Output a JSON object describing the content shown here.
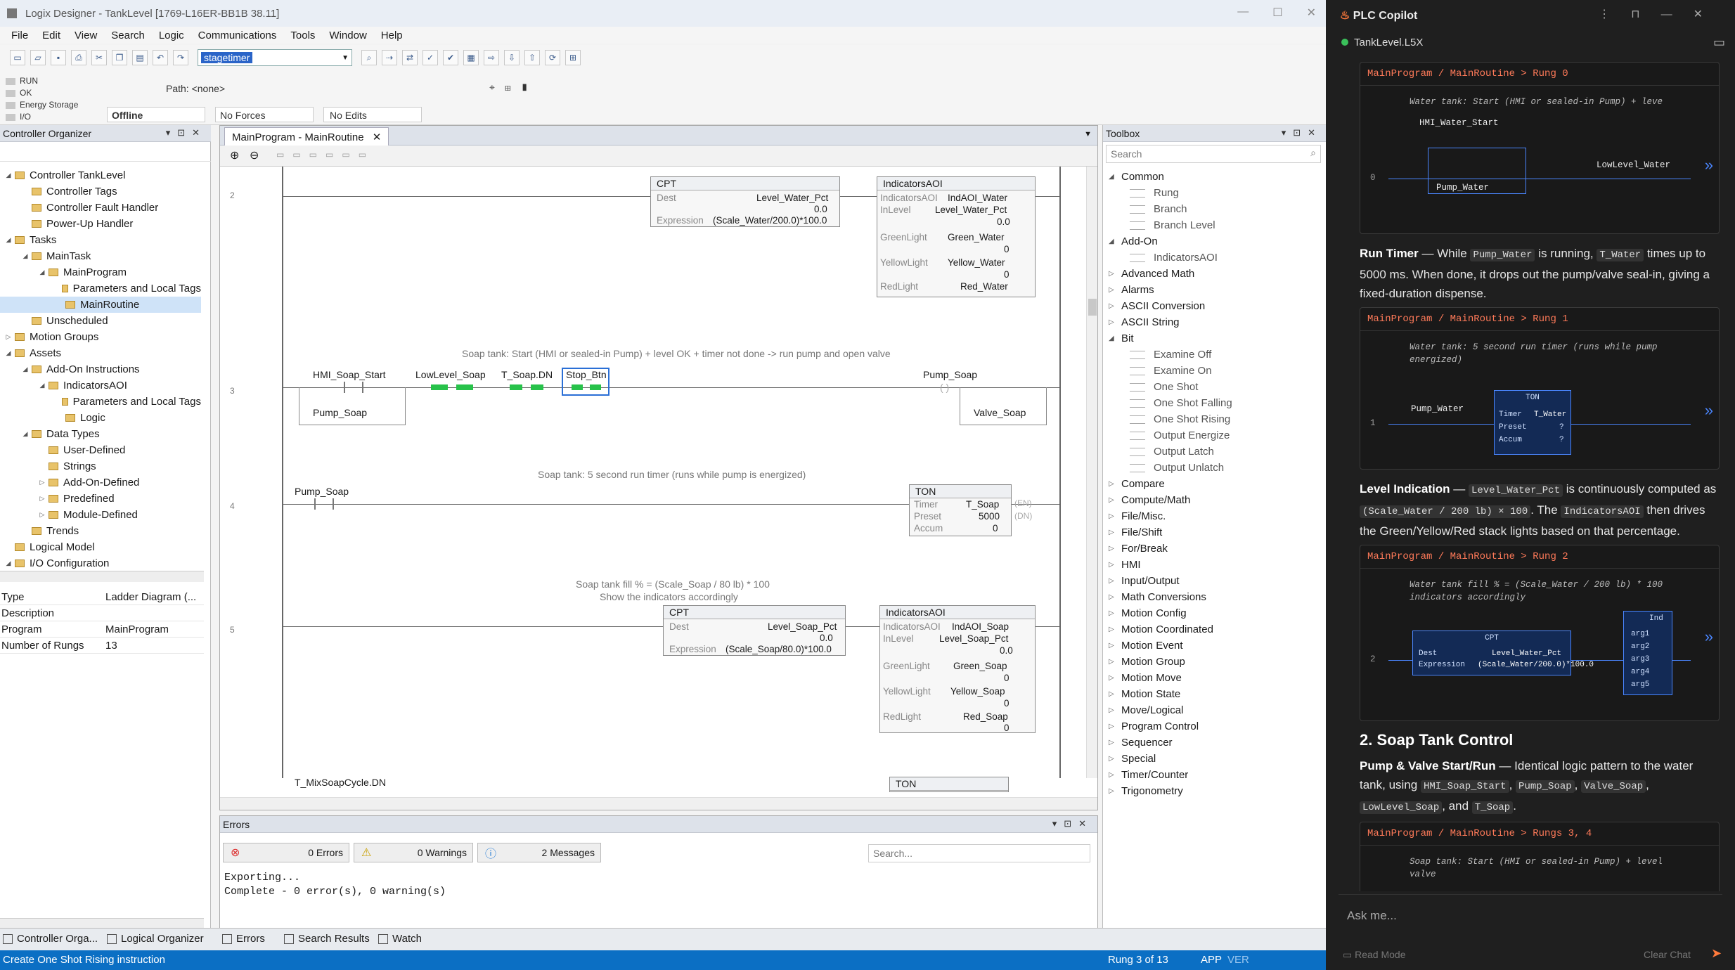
{
  "window": {
    "title": "Logix Designer - TankLevel [1769-L16ER-BB1B 38.11]"
  },
  "menu": [
    "File",
    "Edit",
    "View",
    "Search",
    "Logic",
    "Communications",
    "Tools",
    "Window",
    "Help"
  ],
  "toolbar": {
    "combo_value": "stagetimer"
  },
  "controller_status": {
    "run": "RUN",
    "ok": "OK",
    "energy": "Energy Storage",
    "io": "I/O",
    "mode": "Offline",
    "forces": "No Forces",
    "edits": "No Edits",
    "path_label": "Path:",
    "path_value": "<none>"
  },
  "organizer": {
    "title": "Controller Organizer",
    "tree": [
      {
        "label": "Controller TankLevel",
        "indent": 0,
        "exp": "◢"
      },
      {
        "label": "Controller Tags",
        "indent": 1,
        "exp": ""
      },
      {
        "label": "Controller Fault Handler",
        "indent": 1,
        "exp": ""
      },
      {
        "label": "Power-Up Handler",
        "indent": 1,
        "exp": ""
      },
      {
        "label": "Tasks",
        "indent": 0,
        "exp": "◢"
      },
      {
        "label": "MainTask",
        "indent": 1,
        "exp": "◢"
      },
      {
        "label": "MainProgram",
        "indent": 2,
        "exp": "◢"
      },
      {
        "label": "Parameters and Local Tags",
        "indent": 3,
        "exp": ""
      },
      {
        "label": "MainRoutine",
        "indent": 3,
        "exp": "",
        "selected": true
      },
      {
        "label": "Unscheduled",
        "indent": 1,
        "exp": ""
      },
      {
        "label": "Motion Groups",
        "indent": 0,
        "exp": "▷"
      },
      {
        "label": "Assets",
        "indent": 0,
        "exp": "◢"
      },
      {
        "label": "Add-On Instructions",
        "indent": 1,
        "exp": "◢"
      },
      {
        "label": "IndicatorsAOI",
        "indent": 2,
        "exp": "◢"
      },
      {
        "label": "Parameters and Local Tags",
        "indent": 3,
        "exp": ""
      },
      {
        "label": "Logic",
        "indent": 3,
        "exp": ""
      },
      {
        "label": "Data Types",
        "indent": 1,
        "exp": "◢"
      },
      {
        "label": "User-Defined",
        "indent": 2,
        "exp": ""
      },
      {
        "label": "Strings",
        "indent": 2,
        "exp": ""
      },
      {
        "label": "Add-On-Defined",
        "indent": 2,
        "exp": "▷"
      },
      {
        "label": "Predefined",
        "indent": 2,
        "exp": "▷"
      },
      {
        "label": "Module-Defined",
        "indent": 2,
        "exp": "▷"
      },
      {
        "label": "Trends",
        "indent": 1,
        "exp": ""
      },
      {
        "label": "Logical Model",
        "indent": 0,
        "exp": ""
      },
      {
        "label": "I/O Configuration",
        "indent": 0,
        "exp": "◢"
      }
    ],
    "props": [
      {
        "k": "Type",
        "v": "Ladder Diagram (..."
      },
      {
        "k": "Description",
        "v": ""
      },
      {
        "k": "Program",
        "v": "MainProgram"
      },
      {
        "k": "Number of Rungs",
        "v": "13"
      }
    ]
  },
  "editor": {
    "tab": "MainProgram - MainRoutine",
    "rung2": {
      "cpt_title": "CPT",
      "cpt_dest_label": "Dest",
      "cpt_dest": "Level_Water_Pct",
      "cpt_dest_val": "0.0",
      "cpt_expr_label": "Expression",
      "cpt_expr": "(Scale_Water/200.0)*100.0",
      "aoi_title": "IndicatorsAOI",
      "aoi_inst": "IndAOI_Water",
      "aoi_inlevel": "Level_Water_Pct",
      "aoi_inlevel_val": "0.0",
      "aoi_green": "Green_Water",
      "aoi_yellow": "Yellow_Water",
      "aoi_red": "Red_Water",
      "zero": "0"
    },
    "rung3": {
      "comment": "Soap tank: Start (HMI or sealed-in Pump) + level OK + timer not done -> run pump and open valve",
      "c1": "HMI_Soap_Start",
      "c2": "LowLevel_Soap",
      "c3": "T_Soap.DN",
      "c4": "Stop_Btn",
      "seal": "Pump_Soap",
      "out1": "Pump_Soap",
      "out2": "Valve_Soap"
    },
    "rung4": {
      "comment": "Soap tank: 5 second run timer (runs while pump is energized)",
      "c1": "Pump_Soap",
      "ton": "TON",
      "timer_label": "Timer",
      "timer": "T_Soap",
      "preset_label": "Preset",
      "preset": "5000",
      "accum_label": "Accum",
      "accum": "0",
      "en": "EN",
      "dn": "DN"
    },
    "rung5": {
      "comment1": "Soap tank fill % = (Scale_Soap / 80 lb) * 100",
      "comment2": "Show the indicators accordingly",
      "cpt_dest": "Level_Soap_Pct",
      "cpt_dest_val": "0.0",
      "cpt_expr": "(Scale_Soap/80.0)*100.0",
      "aoi_inst": "IndAOI_Soap",
      "aoi_inlevel": "Level_Soap_Pct",
      "aoi_inlevel_val": "0.0",
      "aoi_green": "Green_Soap",
      "aoi_yellow": "Yellow_Soap",
      "aoi_red": "Red_Soap"
    },
    "rung6": {
      "c1": "T_MixSoapCycle.DN",
      "ton": "TON"
    },
    "labels": {
      "inlevel": "InLevel",
      "green": "GreenLight",
      "yellow": "YellowLight",
      "red": "RedLight"
    },
    "rung_numbers": [
      "2",
      "3",
      "4",
      "5"
    ]
  },
  "errors": {
    "title": "Errors",
    "errors": "0 Errors",
    "warnings": "0 Warnings",
    "messages": "2 Messages",
    "search": "Search...",
    "log": [
      "Exporting...",
      "Complete - 0 error(s), 0 warning(s)"
    ]
  },
  "toolbox": {
    "title": "Toolbox",
    "search": "Search",
    "items": [
      {
        "t": "cat",
        "label": "Common",
        "open": true
      },
      {
        "t": "sub",
        "label": "Rung"
      },
      {
        "t": "sub",
        "label": "Branch"
      },
      {
        "t": "sub",
        "label": "Branch Level"
      },
      {
        "t": "cat",
        "label": "Add-On",
        "open": true
      },
      {
        "t": "sub",
        "label": "IndicatorsAOI"
      },
      {
        "t": "cat",
        "label": "Advanced Math"
      },
      {
        "t": "cat",
        "label": "Alarms"
      },
      {
        "t": "cat",
        "label": "ASCII Conversion"
      },
      {
        "t": "cat",
        "label": "ASCII String"
      },
      {
        "t": "cat",
        "label": "Bit",
        "open": true
      },
      {
        "t": "sub",
        "label": "Examine Off"
      },
      {
        "t": "sub",
        "label": "Examine On"
      },
      {
        "t": "sub",
        "label": "One Shot"
      },
      {
        "t": "sub",
        "label": "One Shot Falling"
      },
      {
        "t": "sub",
        "label": "One Shot Rising"
      },
      {
        "t": "sub",
        "label": "Output Energize"
      },
      {
        "t": "sub",
        "label": "Output Latch"
      },
      {
        "t": "sub",
        "label": "Output Unlatch"
      },
      {
        "t": "cat",
        "label": "Compare"
      },
      {
        "t": "cat",
        "label": "Compute/Math"
      },
      {
        "t": "cat",
        "label": "File/Misc."
      },
      {
        "t": "cat",
        "label": "File/Shift"
      },
      {
        "t": "cat",
        "label": "For/Break"
      },
      {
        "t": "cat",
        "label": "HMI"
      },
      {
        "t": "cat",
        "label": "Input/Output"
      },
      {
        "t": "cat",
        "label": "Math Conversions"
      },
      {
        "t": "cat",
        "label": "Motion Config"
      },
      {
        "t": "cat",
        "label": "Motion Coordinated"
      },
      {
        "t": "cat",
        "label": "Motion Event"
      },
      {
        "t": "cat",
        "label": "Motion Group"
      },
      {
        "t": "cat",
        "label": "Motion Move"
      },
      {
        "t": "cat",
        "label": "Motion State"
      },
      {
        "t": "cat",
        "label": "Move/Logical"
      },
      {
        "t": "cat",
        "label": "Program Control"
      },
      {
        "t": "cat",
        "label": "Sequencer"
      },
      {
        "t": "cat",
        "label": "Special"
      },
      {
        "t": "cat",
        "label": "Timer/Counter"
      },
      {
        "t": "cat",
        "label": "Trigonometry"
      }
    ]
  },
  "bottom_tabs": [
    "Controller Orga...",
    "Logical Organizer",
    "Errors",
    "Search Results",
    "Watch"
  ],
  "statusbar": {
    "left": "Create One Shot Rising instruction",
    "rung": "Rung 3 of 13",
    "app": "APP",
    "ver": "VER"
  },
  "copilot": {
    "title": "PLC Copilot",
    "file": "TankLevel.L5X",
    "card0": {
      "hdr": "MainProgram / MainRoutine > Rung 0",
      "comment": "Water tank: Start (HMI or sealed-in Pump) + leve",
      "n1": "HMI_Water_Start",
      "n2": "Pump_Water",
      "n3": "LowLevel_Water",
      "rung": "0"
    },
    "p1": {
      "title": "Run Timer",
      "dash": "— While",
      "c1": "Pump_Water",
      "t1": "is running,",
      "c2": "T_Water",
      "t2": "times up to 5000 ms. When done, it drops out the pump/valve seal-in, giving a fixed-duration dispense."
    },
    "card1": {
      "hdr": "MainProgram / MainRoutine > Rung 1",
      "comment": "Water tank: 5 second run timer (runs while pump energized)",
      "n1": "Pump_Water",
      "ton": "TON",
      "timer": "Timer",
      "timer_v": "T_Water",
      "preset": "Preset",
      "accum": "Accum",
      "q": "?",
      "rung": "1"
    },
    "p2": {
      "title": "Level Indication",
      "dash": "—",
      "c1": "Level_Water_Pct",
      "t1": "is continuously computed as",
      "c2": "(Scale_Water / 200 lb) × 100",
      "t2": ". The",
      "c3": "IndicatorsAOI",
      "t3": "then drives the Green/Yellow/Red stack lights based on that percentage."
    },
    "card2": {
      "hdr": "MainProgram / MainRoutine > Rung 2",
      "comment": "Water tank fill % = (Scale_Water / 200 lb) * 100",
      "comment2": "indicators accordingly",
      "cpt": "CPT",
      "dest": "Dest",
      "dest_v": "Level_Water_Pct",
      "expr": "Expression",
      "expr_v": "(Scale_Water/200.0)*100.0",
      "ind": "Ind",
      "args": [
        "arg1",
        "arg2",
        "arg3",
        "arg4",
        "arg5"
      ],
      "rung": "2"
    },
    "h2": "2. Soap Tank Control",
    "p3": {
      "title": "Pump & Valve Start/Run",
      "dash": "— Identical logic pattern to the water tank, using",
      "c1": "HMI_Soap_Start",
      "c2": "Pump_Soap",
      "c3": "Valve_Soap",
      "c4": "LowLevel_Soap",
      "and": ", and",
      "c5": "T_Soap"
    },
    "card3": {
      "hdr": "MainProgram / MainRoutine > Rungs 3, 4",
      "comment": "Soap tank: Start (HMI or sealed-in Pump) + level",
      "comment2": "valve"
    },
    "ask": "Ask me...",
    "read_mode": "Read Mode",
    "clear": "Clear Chat"
  }
}
